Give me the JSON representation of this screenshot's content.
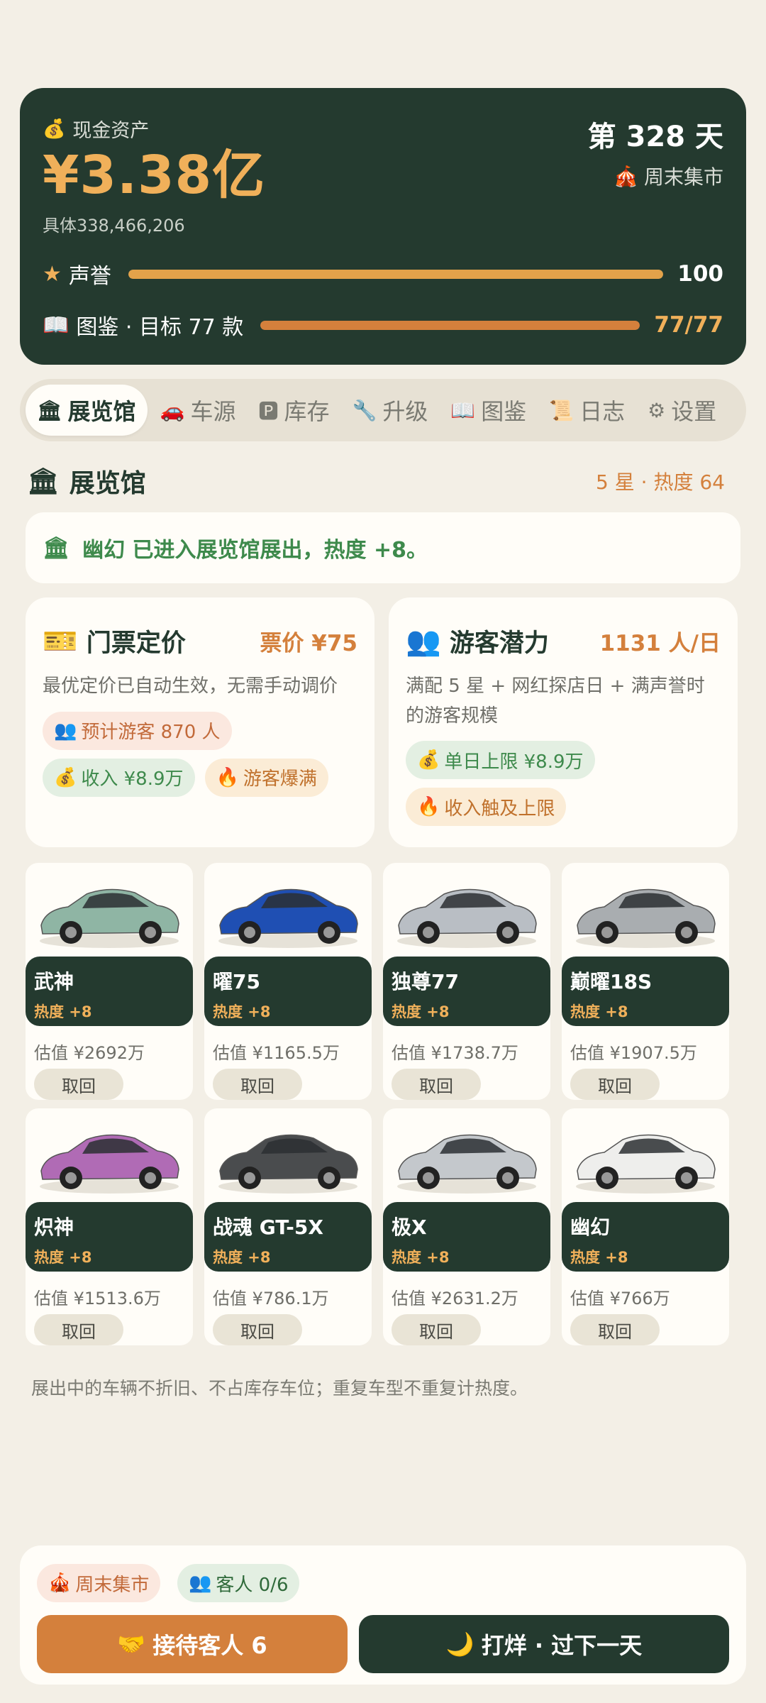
{
  "header": {
    "cash_icon": "money-bag-icon",
    "cash_label": "现金资产",
    "cash_value": "¥3.38亿",
    "cash_exact": "具体338,466,206",
    "day": "第 328 天",
    "market": "周末集市",
    "market_icon": "tent-icon",
    "reputation": {
      "label": "声誉",
      "value": "100",
      "progress": 1.0,
      "color": "#e3a24a"
    },
    "codex": {
      "label": "图鉴 · 目标 77 款",
      "value": "77/77",
      "progress": 1.0,
      "color": "#d4803c"
    }
  },
  "tabs": [
    {
      "icon": "🏛",
      "label": "展览馆",
      "active": true
    },
    {
      "icon": "🚗",
      "label": "车源",
      "active": false
    },
    {
      "icon": "🅿",
      "label": "库存",
      "active": false
    },
    {
      "icon": "🔧",
      "label": "升级",
      "active": false
    },
    {
      "icon": "📖",
      "label": "图鉴",
      "active": false
    },
    {
      "icon": "📜",
      "label": "日志",
      "active": false
    },
    {
      "icon": "⚙",
      "label": "设置",
      "active": false
    }
  ],
  "section": {
    "title": "展览馆",
    "meta": "5 星 · 热度 64"
  },
  "notice": "幽幻 已进入展览馆展出，热度 +8。",
  "ticket": {
    "title": "门票定价",
    "value": "票价 ¥75",
    "desc": "最优定价已自动生效，无需手动调价",
    "chips": [
      "预计游客 870 人",
      "收入 ¥8.9万",
      "游客爆满"
    ]
  },
  "visitors": {
    "title": "游客潜力",
    "value": "1131 人/日",
    "desc": "满配 5 星 + 网红探店日 + 满声誉时的游客规模",
    "chips": [
      "单日上限 ¥8.9万",
      "收入触及上限"
    ]
  },
  "cars": [
    {
      "name": "武神",
      "heat": "热度 +8",
      "estimate": "估值 ¥2692万",
      "action": "取回",
      "color": "#8fb5a4"
    },
    {
      "name": "曜75",
      "heat": "热度 +8",
      "estimate": "估值 ¥1165.5万",
      "action": "取回",
      "color": "#1f4fb3"
    },
    {
      "name": "独尊77",
      "heat": "热度 +8",
      "estimate": "估值 ¥1738.7万",
      "action": "取回",
      "color": "#b9bec4"
    },
    {
      "name": "巅曜18S",
      "heat": "热度 +8",
      "estimate": "估值 ¥1907.5万",
      "action": "取回",
      "color": "#a9adb0"
    },
    {
      "name": "炽神",
      "heat": "热度 +8",
      "estimate": "估值 ¥1513.6万",
      "action": "取回",
      "color": "#b06bb5"
    },
    {
      "name": "战魂 GT-5X",
      "heat": "热度 +8",
      "estimate": "估值 ¥786.1万",
      "action": "取回",
      "color": "#4a4c4e"
    },
    {
      "name": "极X",
      "heat": "热度 +8",
      "estimate": "估值 ¥2631.2万",
      "action": "取回",
      "color": "#c4c8cc"
    },
    {
      "name": "幽幻",
      "heat": "热度 +8",
      "estimate": "估值 ¥766万",
      "action": "取回",
      "color": "#eeeeec"
    }
  ],
  "footnote": "展出中的车辆不折旧、不占库存车位；重复车型不重复计热度。",
  "bottom": {
    "market_chip": "周末集市",
    "guests_chip": "客人 0/6",
    "receive_button": "接待客人 6",
    "close_button": "打烊 · 过下一天"
  }
}
